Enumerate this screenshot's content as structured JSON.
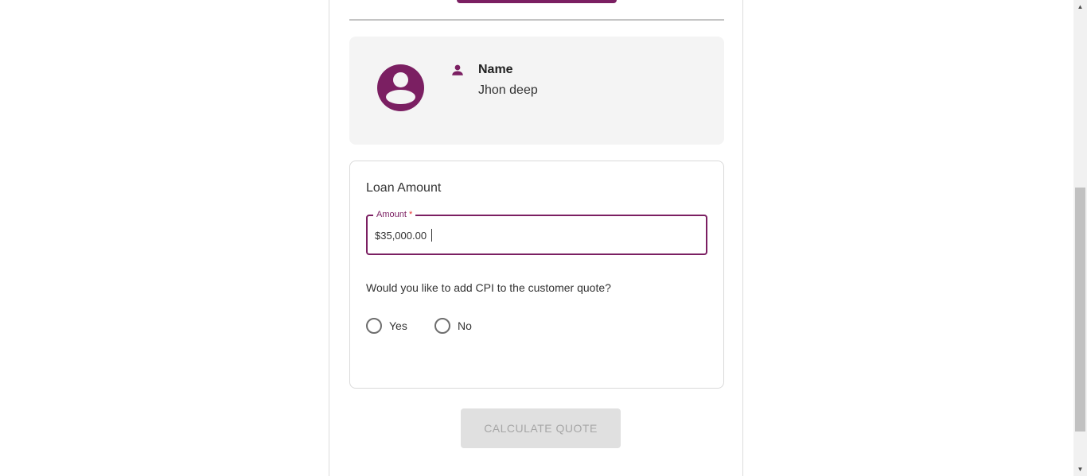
{
  "profile": {
    "name_label": "Name",
    "name_value": "Jhon deep"
  },
  "loan": {
    "title": "Loan Amount",
    "amount_label": "Amount",
    "amount_required_marker": "*",
    "amount_value": "$35,000.00",
    "cpi_question": "Would you like to add CPI to the customer quote?",
    "options": [
      {
        "label": "Yes",
        "selected": false
      },
      {
        "label": "No",
        "selected": false
      }
    ]
  },
  "actions": {
    "calculate_label": "CALCULATE QUOTE"
  },
  "scrollbar": {
    "up_arrow": "▲",
    "down_arrow": "▼"
  },
  "colors": {
    "accent": "#7b1f62",
    "card_bg": "#f4f4f4",
    "disabled_button_bg": "#e0e0e0",
    "disabled_button_text": "#a6a6a6",
    "required": "#e53935"
  },
  "icons": {
    "avatar": "account-circle-icon",
    "name": "person-icon"
  }
}
